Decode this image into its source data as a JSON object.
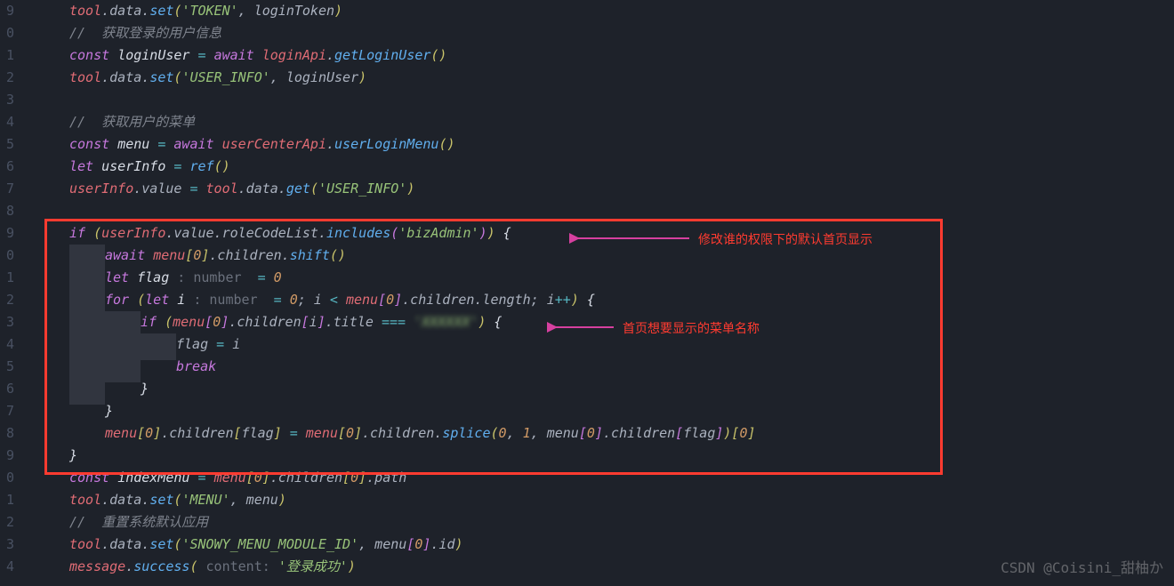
{
  "gutter_start": 9,
  "gutter_lines": [
    "9",
    "0",
    "1",
    "2",
    "3",
    "4",
    "5",
    "6",
    "7",
    "8",
    "9",
    "0",
    "1",
    "2",
    "3",
    "4",
    "5",
    "6",
    "7",
    "8",
    "9",
    "0",
    "1",
    "2",
    "3",
    "4"
  ],
  "code": {
    "l0": {
      "a": "tool",
      "b": ".data.",
      "c": "set",
      "d": "'TOKEN'",
      "e": ", loginToken"
    },
    "l1": {
      "comment": "//  获取登录的用户信息"
    },
    "l2": {
      "kw": "const ",
      "a": "loginUser ",
      "op": "= ",
      "aw": "await ",
      "obj": "loginApi",
      "dot": ".",
      "fn": "getLoginUser",
      "p": "()"
    },
    "l3": {
      "a": "tool",
      "b": ".data.",
      "c": "set",
      "s": "'USER_INFO'",
      "e": ", loginUser"
    },
    "l5": {
      "comment": "//  获取用户的菜单"
    },
    "l6": {
      "kw": "const ",
      "a": "menu ",
      "op": "= ",
      "aw": "await ",
      "obj": "userCenterApi",
      "dot": ".",
      "fn": "userLoginMenu",
      "p": "()"
    },
    "l7": {
      "kw": "let ",
      "a": "userInfo ",
      "op": "= ",
      "fn": "ref",
      "p": "()"
    },
    "l8": {
      "a": "userInfo",
      "b": ".value ",
      "op": "= ",
      "obj": "tool",
      "c": ".data.",
      "fn": "get",
      "s": "'USER_INFO'"
    },
    "l10": {
      "kw": "if ",
      "a": "userInfo",
      "b": ".value.roleCodeList.",
      "fn": "includes",
      "s": "'bizAdmin'",
      "brace": " {"
    },
    "l11": {
      "aw": "await ",
      "a": "menu",
      "idx": "0",
      "b": ".children.",
      "fn": "shift",
      "p": "()"
    },
    "l12": {
      "kw": "let ",
      "a": "flag ",
      "hint": ": number ",
      "op": " = ",
      "n": "0"
    },
    "l13": {
      "kw": "for ",
      "kw2": "let ",
      "a": "i ",
      "hint": ": number ",
      "op": " = ",
      "n0": "0",
      "sep": "; i ",
      "lt": "< ",
      "m": "menu",
      "idx": "0",
      "b": ".children.length; i",
      "inc": "++",
      "brace": " {"
    },
    "l14": {
      "kw": "if ",
      "a": "menu",
      "idx": "0",
      "b": ".children",
      "c": "i",
      "d": ".title ",
      "eq": "=== ",
      "s": "'XXXXXX'",
      "brace": " {"
    },
    "l15": {
      "a": "flag ",
      "op": "= ",
      "b": "i"
    },
    "l16": {
      "kw": "break"
    },
    "l17": {
      "brace": "}"
    },
    "l18": {
      "brace": "}"
    },
    "l19": {
      "a": "menu",
      "idx": "0",
      "b": ".children",
      "c": "flag",
      "op": " = ",
      "m2": "menu",
      "idx2": "0",
      "d": ".children.",
      "fn": "splice",
      "args": "0, 1, menu[0].children[flag])[0]"
    },
    "l20": {
      "brace": "}"
    },
    "l21": {
      "kw": "const ",
      "a": "indexMenu ",
      "op": "= ",
      "m": "menu",
      "idx": "0",
      "b": ".children",
      "idx2": "0",
      "c": ".path"
    },
    "l22": {
      "a": "tool",
      "b": ".data.",
      "fn": "set",
      "s": "'MENU'",
      "e": ", menu"
    },
    "l23": {
      "comment": "//  重置系统默认应用"
    },
    "l24": {
      "a": "tool",
      "b": ".data.",
      "fn": "set",
      "s": "'SNOWY_MENU_MODULE_ID'",
      "e": ", menu",
      "idx": "0",
      "c": ".id"
    },
    "l25": {
      "a": "message",
      "b": ".",
      "fn": "success",
      "hint": " content: ",
      "s": "'登录成功'"
    }
  },
  "annotations": {
    "a1": "修改谁的权限下的默认首页显示",
    "a2": "首页想要显示的菜单名称"
  },
  "watermark": "CSDN @Coisini_甜柚か"
}
